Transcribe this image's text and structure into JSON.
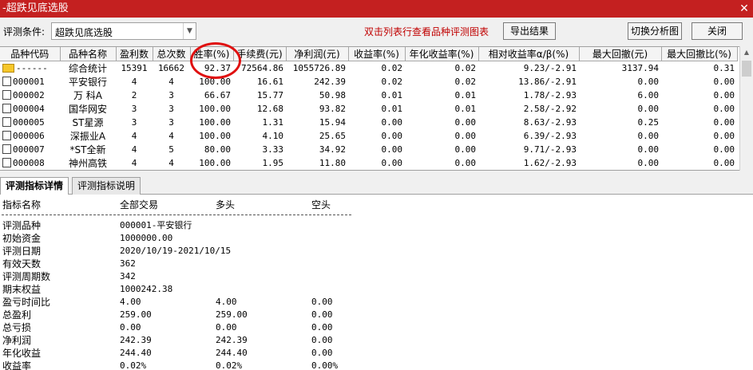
{
  "window": {
    "title": "-超跌见底选股",
    "close_glyph": "✕"
  },
  "toolbar": {
    "condition_label": "评测条件:",
    "condition_value": "超跌见底选股",
    "hint": "双击列表行查看品种评测图表",
    "export_label": "导出结果",
    "switch_label": "切换分析图",
    "close_label": "关闭"
  },
  "table": {
    "columns": [
      "品种代码",
      "品种名称",
      "盈利数",
      "总次数",
      "胜率(%)",
      "手续费(元)",
      "净利润(元)",
      "收益率(%)",
      "年化收益率(%)",
      "相对收益率α/β(%)",
      "最大回撤(元)",
      "最大回撤比(%)"
    ],
    "rows": [
      [
        "------",
        "综合统计",
        "15391",
        "16662",
        "92.37",
        "72564.86",
        "1055726.89",
        "0.02",
        "0.02",
        "9.23/-2.91",
        "3137.94",
        "0.31"
      ],
      [
        "000001",
        "平安银行",
        "4",
        "4",
        "100.00",
        "16.61",
        "242.39",
        "0.02",
        "0.02",
        "13.86/-2.91",
        "0.00",
        "0.00"
      ],
      [
        "000002",
        "万 科A",
        "2",
        "3",
        "66.67",
        "15.77",
        "50.98",
        "0.01",
        "0.01",
        "1.78/-2.93",
        "6.00",
        "0.00"
      ],
      [
        "000004",
        "国华网安",
        "3",
        "3",
        "100.00",
        "12.68",
        "93.82",
        "0.01",
        "0.01",
        "2.58/-2.92",
        "0.00",
        "0.00"
      ],
      [
        "000005",
        "ST星源",
        "3",
        "3",
        "100.00",
        "1.31",
        "15.94",
        "0.00",
        "0.00",
        "8.63/-2.93",
        "0.25",
        "0.00"
      ],
      [
        "000006",
        "深振业A",
        "4",
        "4",
        "100.00",
        "4.10",
        "25.65",
        "0.00",
        "0.00",
        "6.39/-2.93",
        "0.00",
        "0.00"
      ],
      [
        "000007",
        "*ST全新",
        "4",
        "5",
        "80.00",
        "3.33",
        "34.92",
        "0.00",
        "0.00",
        "9.71/-2.93",
        "0.00",
        "0.00"
      ],
      [
        "000008",
        "神州高铁",
        "4",
        "4",
        "100.00",
        "1.95",
        "11.80",
        "0.00",
        "0.00",
        "1.62/-2.93",
        "0.00",
        "0.00"
      ]
    ]
  },
  "tabs": [
    {
      "label": "评测指标详情",
      "active": true
    },
    {
      "label": "评测指标说明",
      "active": false
    }
  ],
  "detail": {
    "headers": [
      "指标名称",
      "全部交易",
      "多头",
      "空头"
    ],
    "rows": [
      [
        "评测品种",
        "000001-平安银行",
        "",
        ""
      ],
      [
        "初始资金",
        "1000000.00",
        "",
        ""
      ],
      [
        "评测日期",
        "2020/10/19-2021/10/15",
        "",
        ""
      ],
      [
        "有效天数",
        "362",
        "",
        ""
      ],
      [
        "评测周期数",
        "342",
        "",
        ""
      ],
      [
        "期末权益",
        "1000242.38",
        "",
        ""
      ],
      [
        "盈亏时间比",
        "4.00",
        "4.00",
        "0.00"
      ],
      [
        "总盈利",
        "259.00",
        "259.00",
        "0.00"
      ],
      [
        "总亏损",
        "0.00",
        "0.00",
        "0.00"
      ],
      [
        "净利润",
        "242.39",
        "242.39",
        "0.00"
      ],
      [
        "年化收益",
        "244.40",
        "244.40",
        "0.00"
      ],
      [
        "收益率",
        "0.02%",
        "0.02%",
        "0.00%"
      ]
    ]
  }
}
